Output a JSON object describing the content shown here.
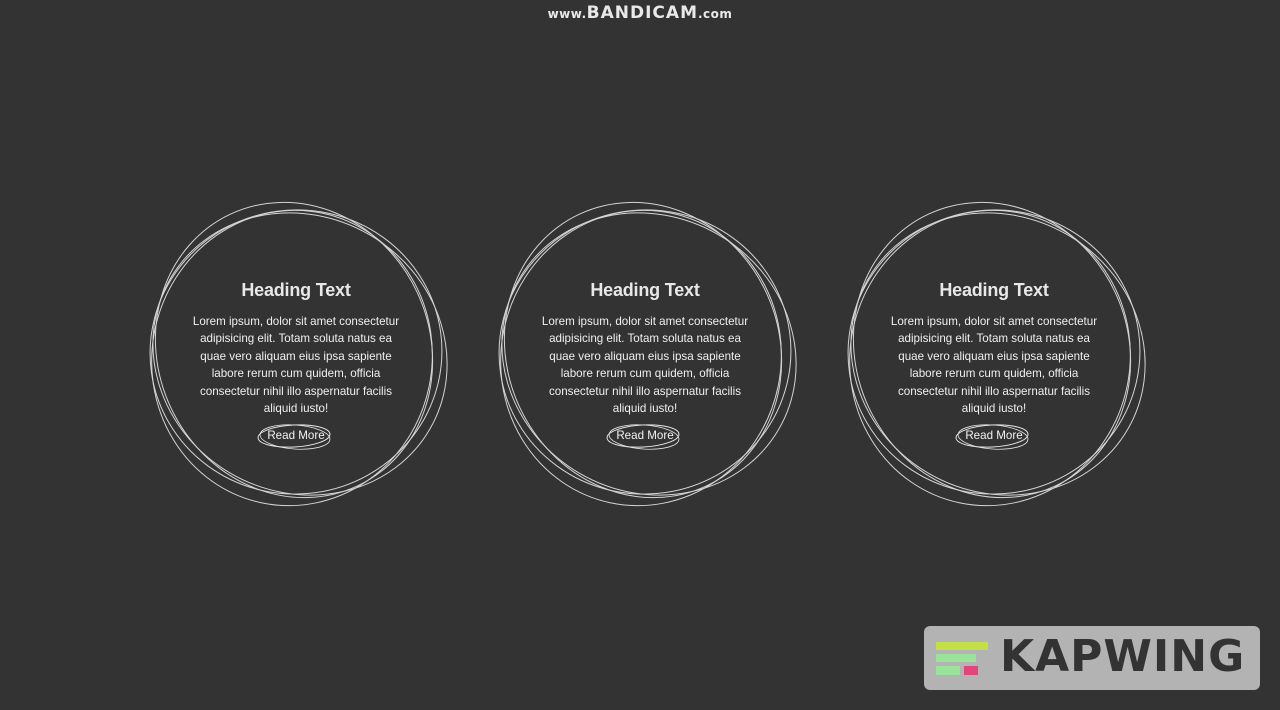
{
  "watermark": {
    "prefix": "www.",
    "brand": "BANDICAM",
    "suffix": ".com"
  },
  "cards": [
    {
      "heading": "Heading Text",
      "body": "Lorem ipsum, dolor sit amet consectetur adipisicing elit. Totam soluta natus ea quae vero aliquam eius ipsa sapiente labore rerum cum quidem, officia consectetur nihil illo aspernatur facilis aliquid iusto!",
      "button_label": "Read More"
    },
    {
      "heading": "Heading Text",
      "body": "Lorem ipsum, dolor sit amet consectetur adipisicing elit. Totam soluta natus ea quae vero aliquam eius ipsa sapiente labore rerum cum quidem, officia consectetur nihil illo aspernatur facilis aliquid iusto!",
      "button_label": "Read More"
    },
    {
      "heading": "Heading Text",
      "body": "Lorem ipsum, dolor sit amet consectetur adipisicing elit. Totam soluta natus ea quae vero aliquam eius ipsa sapiente labore rerum cum quidem, officia consectetur nihil illo aspernatur facilis aliquid iusto!",
      "button_label": "Read More"
    }
  ],
  "kapwing_badge": {
    "text": "KAPWING"
  },
  "colors": {
    "background": "#333333",
    "stroke": "#e6e6e6",
    "text": "#f0f0f0",
    "badge_background": "#b3b3b3",
    "badge_text": "#333333",
    "logo_green": "#9be39b",
    "logo_lime": "#c3e048",
    "logo_pink": "#e0457b"
  }
}
